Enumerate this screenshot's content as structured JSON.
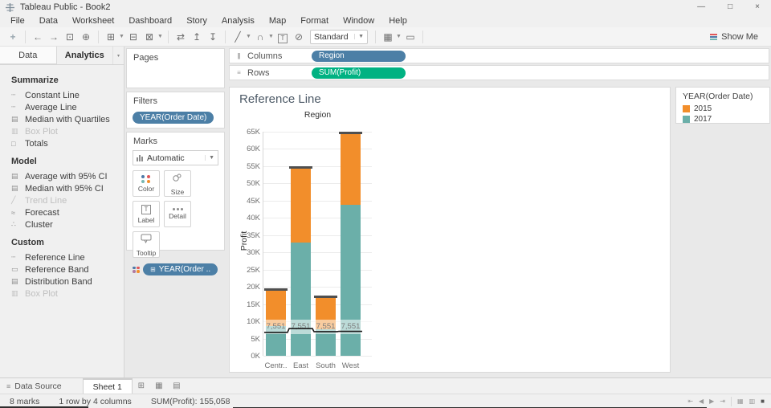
{
  "window": {
    "title": "Tableau Public - Book2",
    "controls": [
      {
        "name": "minimize-button",
        "glyph": "—"
      },
      {
        "name": "restore-button",
        "glyph": "□"
      },
      {
        "name": "close-button",
        "glyph": "×"
      }
    ]
  },
  "menu": {
    "items": [
      "File",
      "Data",
      "Worksheet",
      "Dashboard",
      "Story",
      "Analysis",
      "Map",
      "Format",
      "Window",
      "Help"
    ]
  },
  "toolbar": {
    "view_selector": {
      "value": "Standard"
    },
    "show_me_label": "Show Me",
    "items": [
      {
        "type": "icon",
        "name": "tableau-logo-icon",
        "glyph": "+"
      },
      {
        "type": "sep"
      },
      {
        "type": "icon",
        "name": "undo-icon",
        "glyph": "←"
      },
      {
        "type": "icon",
        "name": "redo-icon",
        "glyph": "→"
      },
      {
        "type": "icon",
        "name": "save-icon",
        "glyph": "⊡"
      },
      {
        "type": "icon",
        "name": "new-data-source-icon",
        "glyph": "⊕"
      },
      {
        "type": "sep"
      },
      {
        "type": "icon",
        "name": "new-worksheet-icon",
        "glyph": "⊞"
      },
      {
        "type": "caret"
      },
      {
        "type": "icon",
        "name": "duplicate-sheet-icon",
        "glyph": "⊟"
      },
      {
        "type": "icon",
        "name": "clear-sheet-icon",
        "glyph": "⊠"
      },
      {
        "type": "caret"
      },
      {
        "type": "sep"
      },
      {
        "type": "icon",
        "name": "swap-rows-columns-icon",
        "glyph": "⇄"
      },
      {
        "type": "icon",
        "name": "sort-ascending-icon",
        "glyph": "↥"
      },
      {
        "type": "icon",
        "name": "sort-descending-icon",
        "glyph": "↧"
      },
      {
        "type": "sep"
      },
      {
        "type": "icon",
        "name": "highlight-icon",
        "glyph": "╱"
      },
      {
        "type": "caret"
      },
      {
        "type": "icon",
        "name": "group-members-icon",
        "glyph": "∩"
      },
      {
        "type": "caret"
      },
      {
        "type": "boxT",
        "name": "show-mark-labels-icon",
        "glyph": "T"
      },
      {
        "type": "icon",
        "name": "fix-axes-icon",
        "glyph": "⊘"
      },
      {
        "type": "select",
        "name": "view-mode-select"
      },
      {
        "type": "sep"
      },
      {
        "type": "icon",
        "name": "show-hide-cards-icon",
        "glyph": "▦"
      },
      {
        "type": "caret"
      },
      {
        "type": "icon",
        "name": "presentation-mode-icon",
        "glyph": "▭"
      },
      {
        "type": "sep"
      },
      {
        "type": "spacer"
      },
      {
        "type": "showme",
        "name": "show-me-button"
      }
    ]
  },
  "sidebar": {
    "tabs": [
      {
        "label": "Data",
        "active": false
      },
      {
        "label": "Analytics",
        "active": true
      }
    ],
    "sections": [
      {
        "title": "Summarize",
        "items": [
          {
            "label": "Constant Line",
            "icon": "constant-line-icon",
            "disabled": false
          },
          {
            "label": "Average Line",
            "icon": "average-line-icon",
            "disabled": false
          },
          {
            "label": "Median with Quartiles",
            "icon": "median-quartiles-icon",
            "disabled": false
          },
          {
            "label": "Box Plot",
            "icon": "box-plot-icon",
            "disabled": true
          },
          {
            "label": "Totals",
            "icon": "totals-icon",
            "disabled": false
          }
        ]
      },
      {
        "title": "Model",
        "items": [
          {
            "label": "Average with 95% CI",
            "icon": "average-ci-icon",
            "disabled": false
          },
          {
            "label": "Median with 95% CI",
            "icon": "median-ci-icon",
            "disabled": false
          },
          {
            "label": "Trend Line",
            "icon": "trend-line-icon",
            "disabled": true
          },
          {
            "label": "Forecast",
            "icon": "forecast-icon",
            "disabled": false
          },
          {
            "label": "Cluster",
            "icon": "cluster-icon",
            "disabled": false
          }
        ]
      },
      {
        "title": "Custom",
        "items": [
          {
            "label": "Reference Line",
            "icon": "reference-line-icon",
            "disabled": false
          },
          {
            "label": "Reference Band",
            "icon": "reference-band-icon",
            "disabled": false
          },
          {
            "label": "Distribution Band",
            "icon": "distribution-band-icon",
            "disabled": false
          },
          {
            "label": "Box Plot",
            "icon": "box-plot-icon",
            "disabled": true
          }
        ]
      }
    ]
  },
  "shelves": {
    "pages": {
      "label": "Pages",
      "pills": []
    },
    "filters": {
      "label": "Filters",
      "pills": [
        {
          "label": "YEAR(Order Date)",
          "type": "dimension"
        }
      ]
    },
    "marks": {
      "label": "Marks",
      "mark_type": "Automatic",
      "buttons": [
        {
          "label": "Color",
          "icon": "color-icon"
        },
        {
          "label": "Size",
          "icon": "size-icon"
        },
        {
          "label": "Label",
          "icon": "label-icon"
        },
        {
          "label": "Detail",
          "icon": "detail-icon"
        },
        {
          "label": "Tooltip",
          "icon": "tooltip-icon"
        }
      ],
      "pills": [
        {
          "label": "YEAR(Order ..",
          "type": "dimension",
          "prefix_icon": "field-icon"
        }
      ]
    },
    "columns": {
      "label": "Columns",
      "pills": [
        {
          "label": "Region",
          "type": "dimension"
        }
      ]
    },
    "rows": {
      "label": "Rows",
      "pills": [
        {
          "label": "SUM(Profit)",
          "type": "measure"
        }
      ]
    }
  },
  "legend": {
    "title": "YEAR(Order Date)",
    "items": [
      {
        "label": "2015",
        "color": "#F28E2B"
      },
      {
        "label": "2017",
        "color": "#6BAFA9"
      }
    ]
  },
  "chart_data": {
    "type": "bar",
    "stacked": true,
    "title": "Reference Line",
    "column_header": "Region",
    "ylabel": "Profit",
    "categories": [
      "Centr..",
      "East",
      "South",
      "West"
    ],
    "series": [
      {
        "name": "2017",
        "color": "#6BAFA9",
        "values": [
          8600,
          32900,
          7800,
          43700
        ]
      },
      {
        "name": "2015",
        "color": "#F28E2B",
        "values": [
          10400,
          21500,
          9200,
          20800
        ]
      }
    ],
    "bar_totals": [
      19000,
      54400,
      17000,
      64500
    ],
    "ylim": [
      0,
      68000
    ],
    "ytick_step": 5000,
    "ytick_max": 65000,
    "grid": true,
    "bar_caps": true,
    "reference_line": {
      "label": "7,551",
      "value": 7551,
      "per_bar_values": [
        6800,
        7900,
        7000,
        7100
      ]
    }
  },
  "sheet_tabs": {
    "data_source_label": "Data Source",
    "tabs": [
      {
        "label": "Sheet 1",
        "active": true
      }
    ],
    "actions": [
      {
        "name": "new-worksheet-tab-icon",
        "glyph": "⊞"
      },
      {
        "name": "new-dashboard-tab-icon",
        "glyph": "▦"
      },
      {
        "name": "new-story-tab-icon",
        "glyph": "▤"
      }
    ]
  },
  "status_bar": {
    "marks": "8 marks",
    "dimensions": "1 row by 4 columns",
    "aggregation": "SUM(Profit): 155,058",
    "nav_icons": [
      {
        "name": "first-record-icon",
        "glyph": "⇤"
      },
      {
        "name": "previous-record-icon",
        "glyph": "◀"
      },
      {
        "name": "next-record-icon",
        "glyph": "▶"
      },
      {
        "name": "last-record-icon",
        "glyph": "⇥"
      }
    ],
    "view_icons": [
      {
        "name": "grid-view-icon",
        "glyph": "▦",
        "active": false
      },
      {
        "name": "filmstrip-view-icon",
        "glyph": "▥",
        "active": false
      },
      {
        "name": "sheet-view-icon",
        "glyph": "■",
        "active": true
      }
    ]
  },
  "colors": {
    "dimension_pill": "#4C7FA6",
    "measure_pill": "#00B282",
    "bar_orange": "#F28E2B",
    "bar_teal": "#6BAFA9"
  }
}
